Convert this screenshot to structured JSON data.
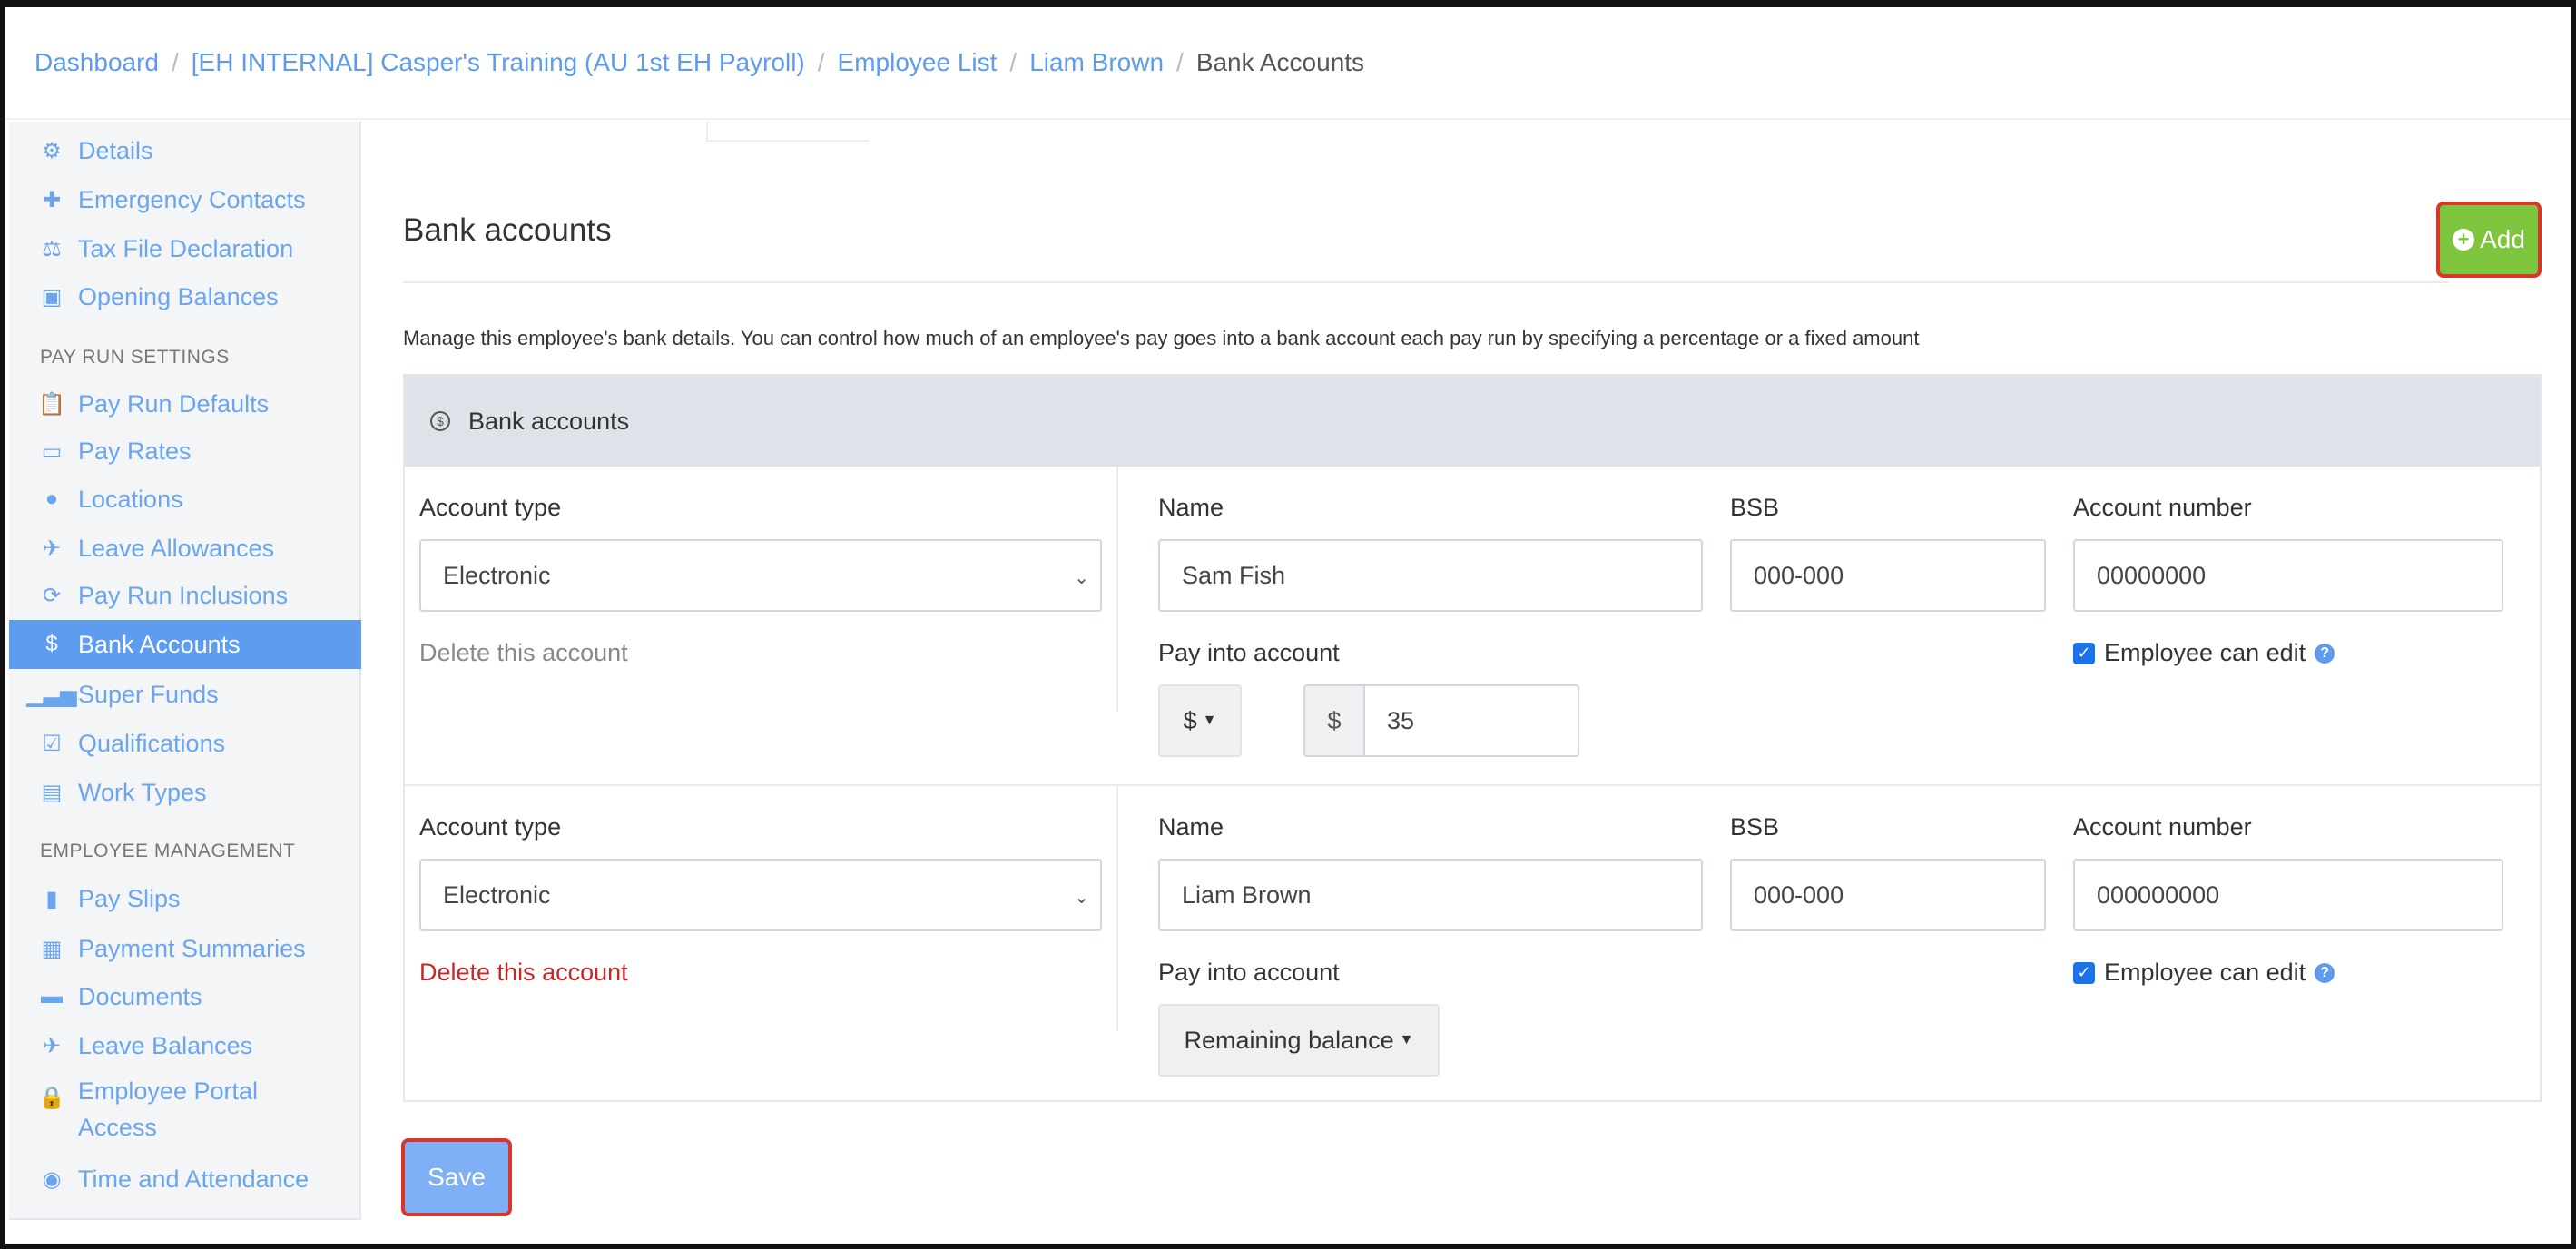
{
  "breadcrumb": {
    "items": [
      "Dashboard",
      "[EH INTERNAL] Casper's Training (AU 1st EH Payroll)",
      "Employee List",
      "Liam Brown"
    ],
    "current": "Bank Accounts",
    "separator": "/"
  },
  "sidebar": {
    "top_items": [
      {
        "label": "Details",
        "icon": "gear-icon"
      },
      {
        "label": "Emergency Contacts",
        "icon": "plus-icon"
      },
      {
        "label": "Tax File Declaration",
        "icon": "scales-icon"
      },
      {
        "label": "Opening Balances",
        "icon": "wallet-icon"
      }
    ],
    "pay_run_heading": "PAY RUN SETTINGS",
    "pay_run_items": [
      {
        "label": "Pay Run Defaults",
        "icon": "clipboard-icon"
      },
      {
        "label": "Pay Rates",
        "icon": "money-icon"
      },
      {
        "label": "Locations",
        "icon": "globe-icon"
      },
      {
        "label": "Leave Allowances",
        "icon": "plane-icon"
      },
      {
        "label": "Pay Run Inclusions",
        "icon": "refresh-icon"
      },
      {
        "label": "Bank Accounts",
        "icon": "dollar-circle-icon"
      },
      {
        "label": "Super Funds",
        "icon": "signal-icon"
      },
      {
        "label": "Qualifications",
        "icon": "check-square-icon"
      },
      {
        "label": "Work Types",
        "icon": "book-icon"
      }
    ],
    "employee_heading": "EMPLOYEE MANAGEMENT",
    "employee_items": [
      {
        "label": "Pay Slips",
        "icon": "file-icon"
      },
      {
        "label": "Payment Summaries",
        "icon": "calculator-icon"
      },
      {
        "label": "Documents",
        "icon": "folder-icon"
      },
      {
        "label": "Leave Balances",
        "icon": "plane-icon"
      },
      {
        "label": "Employee Portal Access",
        "icon": "lock-icon"
      },
      {
        "label": "Time and Attendance",
        "icon": "user-circle-icon"
      }
    ]
  },
  "main": {
    "title": "Bank accounts",
    "add_label": "Add",
    "description": "Manage this employee's bank details. You can control how much of an employee's pay goes into a bank account each pay run by specifying a percentage or a fixed amount",
    "panel_title": "Bank accounts",
    "save_label": "Save",
    "labels": {
      "account_type": "Account type",
      "name": "Name",
      "bsb": "BSB",
      "account_number": "Account number",
      "pay_into": "Pay into account",
      "employee_can_edit": "Employee can edit",
      "delete": "Delete this account"
    },
    "accounts": [
      {
        "account_type": "Electronic",
        "name": "Sam Fish",
        "bsb": "000-000",
        "account_number": "00000000",
        "pay_mode": "$",
        "currency_symbol": "$",
        "amount": "35",
        "employee_can_edit": true
      },
      {
        "account_type": "Electronic",
        "name": "Liam Brown",
        "bsb": "000-000",
        "account_number": "000000000",
        "pay_mode": "Remaining balance",
        "employee_can_edit": true
      }
    ]
  },
  "colors": {
    "link": "#5d9bec",
    "active_nav": "#5e9cf0",
    "add_button": "#7cc53d",
    "highlight_border": "#d9352b",
    "delete_red": "#c62828",
    "panel_header": "#dde3e8"
  }
}
